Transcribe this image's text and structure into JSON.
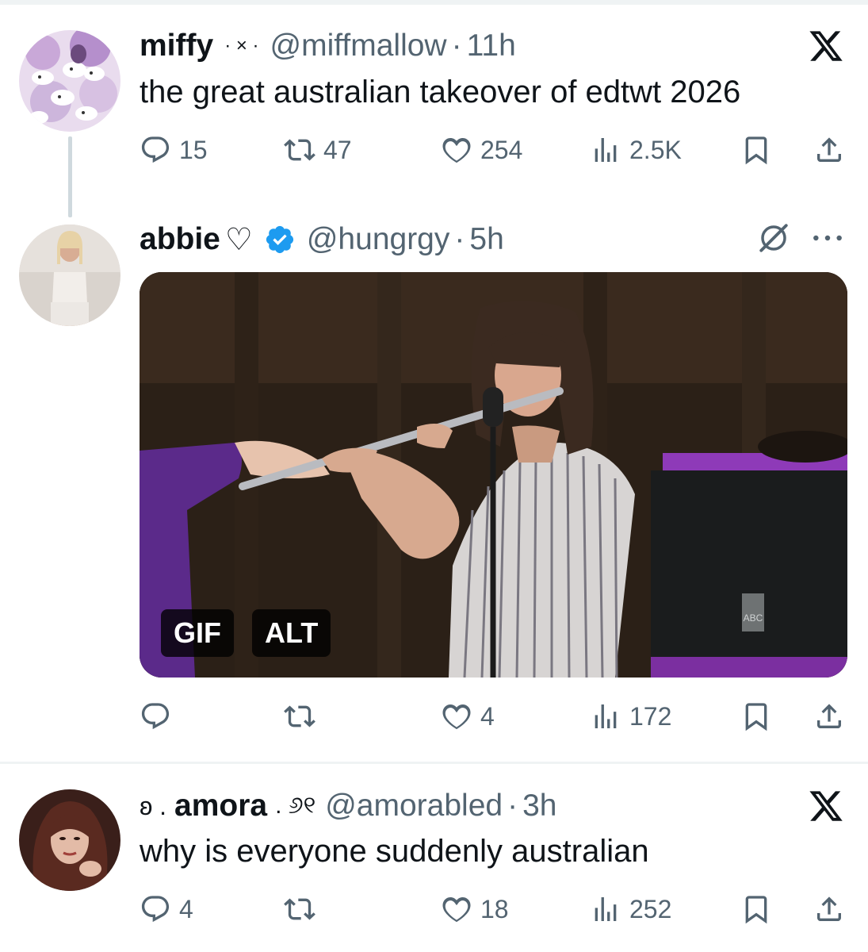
{
  "tweet1": {
    "name": "miffy",
    "name_deco": "· × ·",
    "handle": "@miffmallow",
    "time": "11h",
    "text": "the great australian takeover of edtwt 2026",
    "stats": {
      "replies": "15",
      "retweets": "47",
      "likes": "254",
      "views": "2.5K"
    }
  },
  "tweet2": {
    "name": "abbie",
    "name_deco": "♡",
    "handle": "@hungrgy",
    "time": "5h",
    "media_badges": {
      "gif": "GIF",
      "alt": "ALT"
    },
    "stats": {
      "replies": "",
      "retweets": "",
      "likes": "4",
      "views": "172"
    }
  },
  "tweet3": {
    "name_prefix": "ʚ .",
    "name": "amora",
    "name_suffix": ". ୬୧",
    "handle": "@amorabled",
    "time": "3h",
    "text": "why is everyone suddenly australian",
    "stats": {
      "replies": "4",
      "retweets": "",
      "likes": "18",
      "views": "252"
    }
  },
  "sep": "·",
  "colors": {
    "text": "#0f1419",
    "secondary": "#536471",
    "verified_blue": "#1d9bf0",
    "divider": "#eff3f4"
  },
  "icons": [
    "reply-icon",
    "retweet-icon",
    "like-icon",
    "views-icon",
    "bookmark-icon",
    "share-icon",
    "x-logo-icon",
    "verified-icon",
    "grok-icon",
    "more-icon"
  ]
}
